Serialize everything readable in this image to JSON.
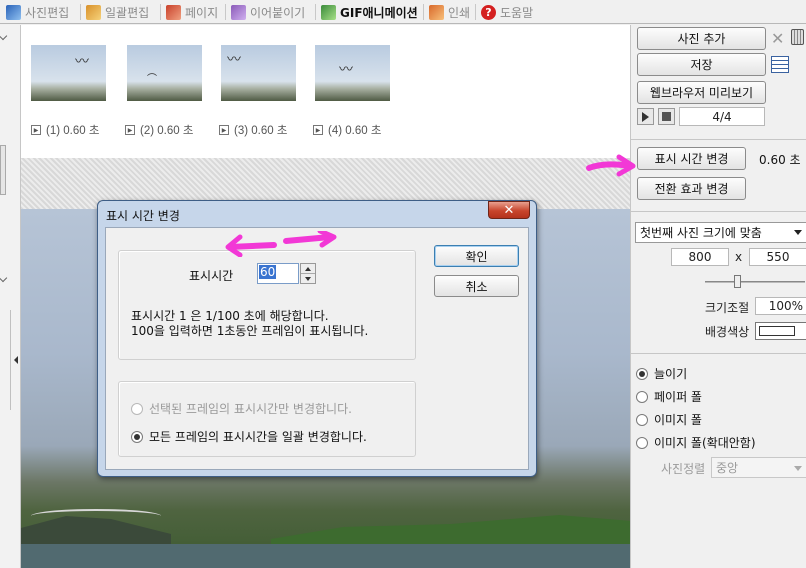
{
  "tabs": [
    {
      "label": "사진편집",
      "icon": "photo-edit-icon",
      "color": "#2a62b8",
      "active": false
    },
    {
      "label": "일괄편집",
      "icon": "batch-edit-icon",
      "color": "#d8902a",
      "active": false
    },
    {
      "label": "페이지",
      "icon": "page-icon",
      "color": "#c8402a",
      "active": false
    },
    {
      "label": "이어붙이기",
      "icon": "join-icon",
      "color": "#8a5ab8",
      "active": false
    },
    {
      "label": "GIF애니메이션",
      "icon": "gif-animation-icon",
      "color": "#3a8a3a",
      "active": true
    },
    {
      "label": "인쇄",
      "icon": "print-icon",
      "color": "#d8682a",
      "active": false
    },
    {
      "label": "도움말",
      "icon": "help-icon",
      "color": "#d42020",
      "active": false
    }
  ],
  "frames": [
    {
      "label": "(1) 0.60 초"
    },
    {
      "label": "(2) 0.60 초"
    },
    {
      "label": "(3) 0.60 초"
    },
    {
      "label": "(4) 0.60 초"
    }
  ],
  "right": {
    "add_photo": "사진 추가",
    "save": "저장",
    "browser_preview": "웹브라우저 미리보기",
    "frame_counter": "4/4",
    "change_display_time": "표시 시간 변경",
    "display_time_value": "0.60 초",
    "change_transition": "전환 효과 변경",
    "size_mode": "첫번째 사진 크기에 맞춤",
    "width": "800",
    "x_sep": "x",
    "height": "550",
    "scale_label": "크기조절",
    "scale_value": "100%",
    "bg_color_label": "배경색상",
    "bg_color": "#ffffff",
    "options": [
      {
        "label": "늘이기",
        "checked": true
      },
      {
        "label": "페이퍼 폴",
        "checked": false
      },
      {
        "label": "이미지 폴",
        "checked": false
      },
      {
        "label": "이미지 폴(확대안함)",
        "checked": false
      }
    ],
    "align_label": "사진정렬",
    "align_value": "중앙"
  },
  "dialog": {
    "title": "표시 시간 변경",
    "field_label": "표시시간",
    "field_value": "60",
    "ok": "확인",
    "cancel": "취소",
    "help_line1": "표시시간 1 은 1/100 초에 해당합니다.",
    "help_line2": "100을 입력하면 1초동안 프레임이 표시됩니다.",
    "option_selected": "선택된 프레임의 표시시간만 변경합니다.",
    "option_all": "모든 프레임의 표시시간을 일괄 변경합니다."
  },
  "annotation_color": "#f238d6"
}
